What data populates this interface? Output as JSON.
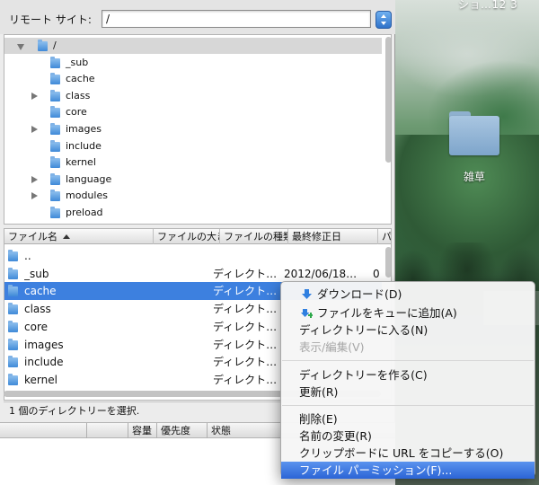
{
  "desktop": {
    "menubar_clock": "ショ…12 3",
    "folder_label": "雑草"
  },
  "remote": {
    "label": "リモート サイト:",
    "path": "/",
    "tree": [
      {
        "name": "/",
        "disclosure": "open",
        "selected": true
      },
      {
        "name": "_sub",
        "disclosure": "none"
      },
      {
        "name": "cache",
        "disclosure": "none"
      },
      {
        "name": "class",
        "disclosure": "closed"
      },
      {
        "name": "core",
        "disclosure": "none"
      },
      {
        "name": "images",
        "disclosure": "closed"
      },
      {
        "name": "include",
        "disclosure": "none"
      },
      {
        "name": "kernel",
        "disclosure": "none"
      },
      {
        "name": "language",
        "disclosure": "closed"
      },
      {
        "name": "modules",
        "disclosure": "closed"
      },
      {
        "name": "preload",
        "disclosure": "none"
      }
    ],
    "columns": [
      "ファイル名",
      "ファイルの大き",
      "ファイルの種類",
      "最終修正日",
      "パー"
    ],
    "rows": [
      {
        "name": "..",
        "type": "",
        "date": "",
        "perm": ""
      },
      {
        "name": "_sub",
        "type": "ディレクト…",
        "date": "2012/06/18…",
        "perm": "0"
      },
      {
        "name": "cache",
        "type": "ディレクト…",
        "date": "",
        "perm": "",
        "selected": true
      },
      {
        "name": "class",
        "type": "ディレクト…",
        "date": "",
        "perm": ""
      },
      {
        "name": "core",
        "type": "ディレクト…",
        "date": "",
        "perm": ""
      },
      {
        "name": "images",
        "type": "ディレクト…",
        "date": "",
        "perm": ""
      },
      {
        "name": "include",
        "type": "ディレクト…",
        "date": "",
        "perm": ""
      },
      {
        "name": "kernel",
        "type": "ディレクト…",
        "date": "",
        "perm": ""
      }
    ],
    "status": "1 個のディレクトリーを選択."
  },
  "queue": {
    "columns": [
      "容量",
      "優先度",
      "状態"
    ]
  },
  "context_menu": {
    "items": [
      {
        "label": "ダウンロード(D)",
        "icon": "download-arrow-icon"
      },
      {
        "label": "ファイルをキューに追加(A)",
        "icon": "add-to-queue-icon"
      },
      {
        "label": "ディレクトリーに入る(N)"
      },
      {
        "label": "表示/編集(V)",
        "disabled": true
      },
      {
        "label": "ディレクトリーを作る(C)"
      },
      {
        "label": "更新(R)"
      },
      {
        "label": "削除(E)"
      },
      {
        "label": "名前の変更(R)"
      },
      {
        "label": "クリップボードに URL をコピーする(O)"
      },
      {
        "label": "ファイル パーミッション(F)...",
        "active": true
      }
    ]
  },
  "colors": {
    "selection": "#3d80df",
    "menu_highlight": "#2b64d6",
    "folder_icon": "#3f8ad8"
  }
}
